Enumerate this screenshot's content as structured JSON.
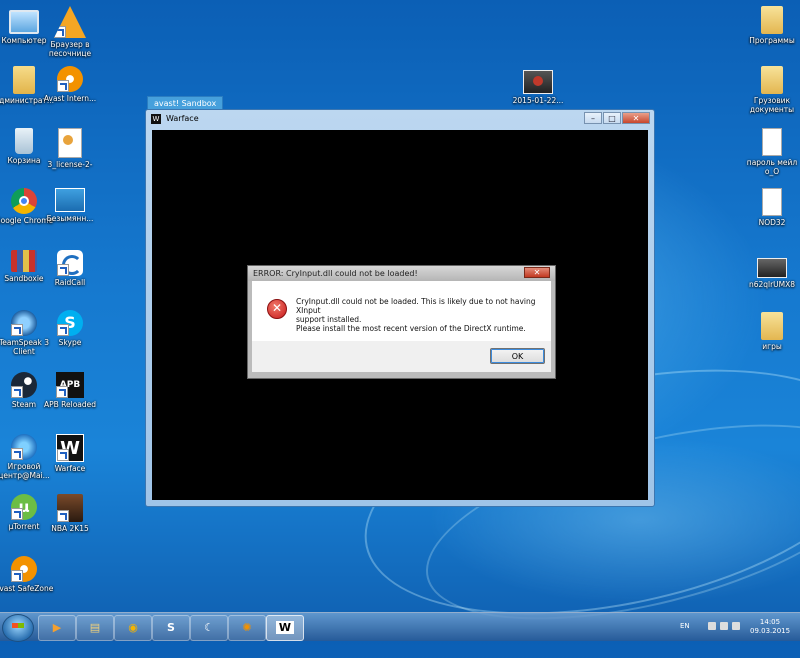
{
  "desktop": {
    "left_icons": [
      {
        "label": "Компьютер",
        "icon": "computer-icon"
      },
      {
        "label": "Браузер в песочнице",
        "icon": "sandbox-browser-icon"
      },
      {
        "label": "Администрат...",
        "icon": "folder-user-icon"
      },
      {
        "label": "Avast Intern...",
        "icon": "avast-icon"
      },
      {
        "label": "Корзина",
        "icon": "recycle-bin-icon"
      },
      {
        "label": "3_license-2-",
        "icon": "document-icon"
      },
      {
        "label": "Google Chrome",
        "icon": "chrome-icon"
      },
      {
        "label": "Безымянн...",
        "icon": "image-icon"
      },
      {
        "label": "Sandboxie",
        "icon": "sandboxie-icon"
      },
      {
        "label": "RaidCall",
        "icon": "raidcall-icon"
      },
      {
        "label": "TeamSpeak 3 Client",
        "icon": "teamspeak-icon"
      },
      {
        "label": "Skype",
        "icon": "skype-icon"
      },
      {
        "label": "Steam",
        "icon": "steam-icon"
      },
      {
        "label": "APB Reloaded",
        "icon": "apb-icon"
      },
      {
        "label": "Игровой центр@Mai...",
        "icon": "game-center-icon"
      },
      {
        "label": "Warface",
        "icon": "warface-icon"
      },
      {
        "label": "µTorrent",
        "icon": "utorrent-icon"
      },
      {
        "label": "NBA 2K15",
        "icon": "nba-icon"
      },
      {
        "label": "Avast SafeZone",
        "icon": "avast-safezone-icon"
      }
    ],
    "middle_icons": [
      {
        "label": "2015-01-22...",
        "icon": "video-file-icon"
      }
    ],
    "right_icons": [
      {
        "label": "Программы",
        "icon": "folder-icon"
      },
      {
        "label": "Грузовик документы",
        "icon": "folder-icon"
      },
      {
        "label": "пароль мейл о_О",
        "icon": "text-file-icon"
      },
      {
        "label": "NOD32",
        "icon": "text-file-icon"
      },
      {
        "label": "n62qlrUMX8",
        "icon": "video-file-icon"
      },
      {
        "label": "игры",
        "icon": "folder-icon"
      }
    ]
  },
  "sandbox_tab": {
    "label": "avast! Sandbox"
  },
  "game_window": {
    "title": "Warface",
    "app_icon_glyph": "W",
    "controls": {
      "minimize": "–",
      "maximize": "□",
      "close": "✕"
    }
  },
  "error_dialog": {
    "title": "ERROR: CryInput.dll could not be loaded!",
    "close_glyph": "✕",
    "error_glyph": "✕",
    "message_line1": "CryInput.dll could not be loaded. This is likely due to not having XInput",
    "message_line2": "support installed.",
    "message_line3": "Please install the most recent version of the DirectX runtime.",
    "ok_label": "OK"
  },
  "taskbar": {
    "pinned": [
      {
        "name": "media-player-icon",
        "glyph": "▶"
      },
      {
        "name": "explorer-icon",
        "glyph": "▤"
      },
      {
        "name": "chrome-icon",
        "glyph": "◉"
      },
      {
        "name": "skype-icon",
        "glyph": "S"
      },
      {
        "name": "raidcall-icon",
        "glyph": "☾"
      },
      {
        "name": "avast-icon",
        "glyph": "✺"
      },
      {
        "name": "warface-icon",
        "glyph": "W"
      }
    ],
    "language": "EN",
    "time": "14:05",
    "date": "09.03.2015"
  }
}
